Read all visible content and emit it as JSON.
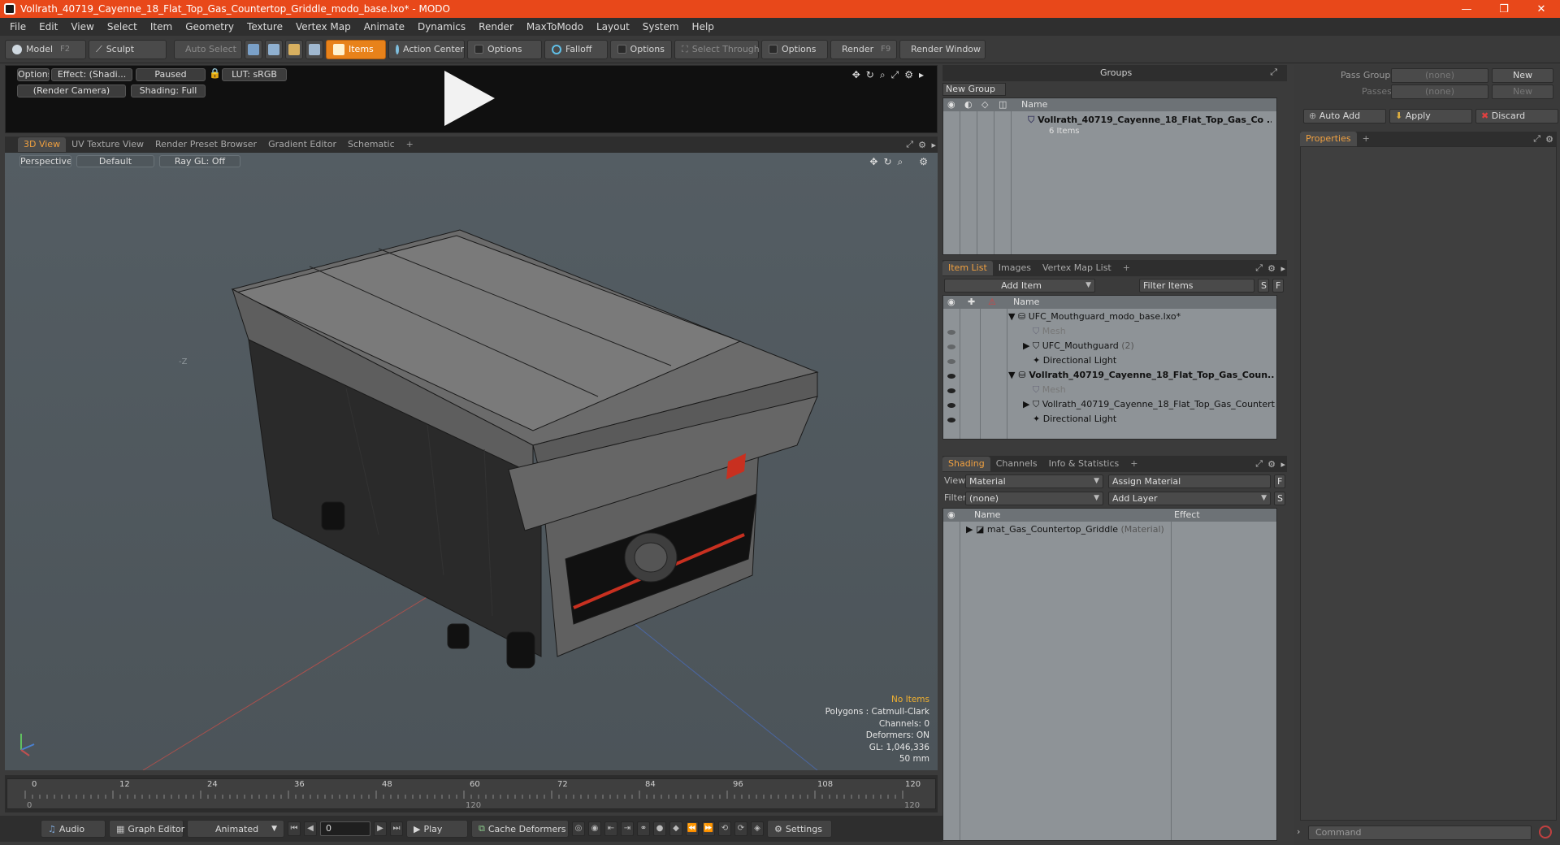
{
  "window": {
    "title": "Vollrath_40719_Cayenne_18_Flat_Top_Gas_Countertop_Griddle_modo_base.lxo* - MODO",
    "minimize": "—",
    "restore": "❐",
    "close": "✕"
  },
  "menu": [
    "File",
    "Edit",
    "View",
    "Select",
    "Item",
    "Geometry",
    "Texture",
    "Vertex Map",
    "Animate",
    "Dynamics",
    "Render",
    "MaxToModo",
    "Layout",
    "System",
    "Help"
  ],
  "toolbar": {
    "model": "Model",
    "model_key": "F2",
    "sculpt": "Sculpt",
    "auto_select": "Auto Select",
    "items": "Items",
    "action_center": "Action Center",
    "options1": "Options",
    "falloff": "Falloff",
    "options2": "Options",
    "select_through": "Select Through",
    "options3": "Options",
    "render": "Render",
    "render_key": "F9",
    "render_window": "Render Window"
  },
  "preview": {
    "options": "Options",
    "effect": "Effect: (Shadi...",
    "paused": "Paused",
    "lut": "LUT: sRGB",
    "camera": "(Render Camera)",
    "shading": "Shading: Full"
  },
  "view_tabs": [
    "3D View",
    "UV Texture View",
    "Render Preset Browser",
    "Gradient Editor",
    "Schematic",
    "+"
  ],
  "view3d": {
    "perspective": "Perspective",
    "default": "Default",
    "raygl": "Ray GL: Off",
    "axis_label": "-Z",
    "stats": {
      "no_items": "No Items",
      "polygons": "Polygons : Catmull-Clark",
      "channels": "Channels: 0",
      "deformers": "Deformers: ON",
      "gl": "GL: 1,046,336",
      "mm": "50 mm"
    }
  },
  "timeline": {
    "top_labels": [
      "0",
      "12",
      "24",
      "36",
      "48",
      "60",
      "72",
      "84",
      "96",
      "108",
      "120"
    ],
    "bottom_labels": [
      "0",
      "120",
      "120"
    ]
  },
  "bottombar": {
    "audio": "Audio",
    "graph_editor": "Graph Editor",
    "animated": "Animated",
    "frame": "0",
    "play": "Play",
    "cache_deformers": "Cache Deformers",
    "settings": "Settings"
  },
  "groups": {
    "title": "Groups",
    "new_group": "New Group",
    "col_name": "Name",
    "item_name": "Vollrath_40719_Cayenne_18_Flat_Top_Gas_Co ...",
    "item_count": "6 Items"
  },
  "itemlist": {
    "tabs": [
      "Item List",
      "Images",
      "Vertex Map List",
      "+"
    ],
    "add_item": "Add Item",
    "filter_items": "Filter Items",
    "s": "S",
    "f": "F",
    "col_name": "Name",
    "rows": [
      {
        "text": "UFC_Mouthguard_modo_base.lxo*",
        "extra": ""
      },
      {
        "text": "Mesh",
        "extra": ""
      },
      {
        "text": "UFC_Mouthguard",
        "extra": "(2)"
      },
      {
        "text": "Directional Light",
        "extra": ""
      },
      {
        "text": "Vollrath_40719_Cayenne_18_Flat_Top_Gas_Coun...",
        "extra": ""
      },
      {
        "text": "Mesh",
        "extra": ""
      },
      {
        "text": "Vollrath_40719_Cayenne_18_Flat_Top_Gas_Countertop...",
        "extra": ""
      },
      {
        "text": "Directional Light",
        "extra": ""
      }
    ]
  },
  "shading": {
    "tabs": [
      "Shading",
      "Channels",
      "Info & Statistics",
      "+"
    ],
    "view_label": "View",
    "view_value": "Material",
    "assign_material": "Assign Material",
    "filter_label": "Filter",
    "filter_value": "(none)",
    "add_layer": "Add Layer",
    "f": "F",
    "s": "S",
    "col_name": "Name",
    "col_effect": "Effect",
    "row_name": "mat_Gas_Countertop_Griddle",
    "row_type": "(Material)"
  },
  "right": {
    "pass_groups": "Pass Groups",
    "pass_groups_value": "(none)",
    "new1": "New",
    "passes": "Passes",
    "passes_value": "(none)",
    "new2": "New",
    "auto_add": "Auto Add",
    "apply": "Apply",
    "discard": "Discard",
    "properties": "Properties",
    "plus": "+",
    "command": "Command"
  },
  "colors": {
    "titlebar": "#e8481a",
    "accent": "#e8821a",
    "panel_bg": "#8e9397"
  }
}
